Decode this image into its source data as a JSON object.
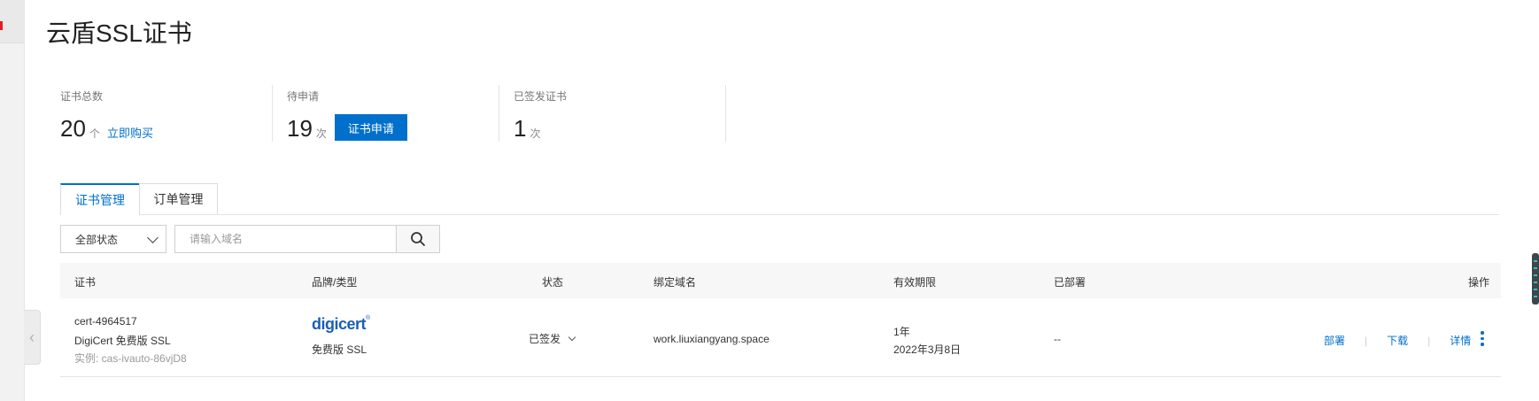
{
  "page": {
    "title": "云盾SSL证书"
  },
  "stats": {
    "total": {
      "label": "证书总数",
      "value": "20",
      "unit": "个",
      "link": "立即购买"
    },
    "pending": {
      "label": "待申请",
      "value": "19",
      "unit": "次",
      "button": "证书申请"
    },
    "issued": {
      "label": "已签发证书",
      "value": "1",
      "unit": "次"
    }
  },
  "tabs": [
    {
      "label": "证书管理",
      "active": true
    },
    {
      "label": "订单管理",
      "active": false
    }
  ],
  "filter": {
    "status_selected": "全部状态",
    "search_placeholder": "请输入域名"
  },
  "table": {
    "headers": {
      "cert": "证书",
      "brand": "品牌/类型",
      "status": "状态",
      "domain": "绑定域名",
      "validity": "有效期限",
      "deployed": "已部署",
      "actions": "操作"
    },
    "rows": [
      {
        "cert_id": "cert-4964517",
        "cert_name": "DigiCert 免费版 SSL",
        "instance": "实例: cas-ivauto-86vjD8",
        "brand_logo": "digicert",
        "brand_type": "免费版 SSL",
        "status": "已签发",
        "domain": "work.liuxiangyang.space",
        "validity_period": "1年",
        "validity_date": "2022年3月8日",
        "deployed": "--",
        "actions": {
          "deploy": "部署",
          "download": "下载",
          "details": "详情"
        }
      }
    ]
  },
  "colors": {
    "accent": "#0070cc",
    "text": "#333333",
    "muted": "#999999"
  }
}
